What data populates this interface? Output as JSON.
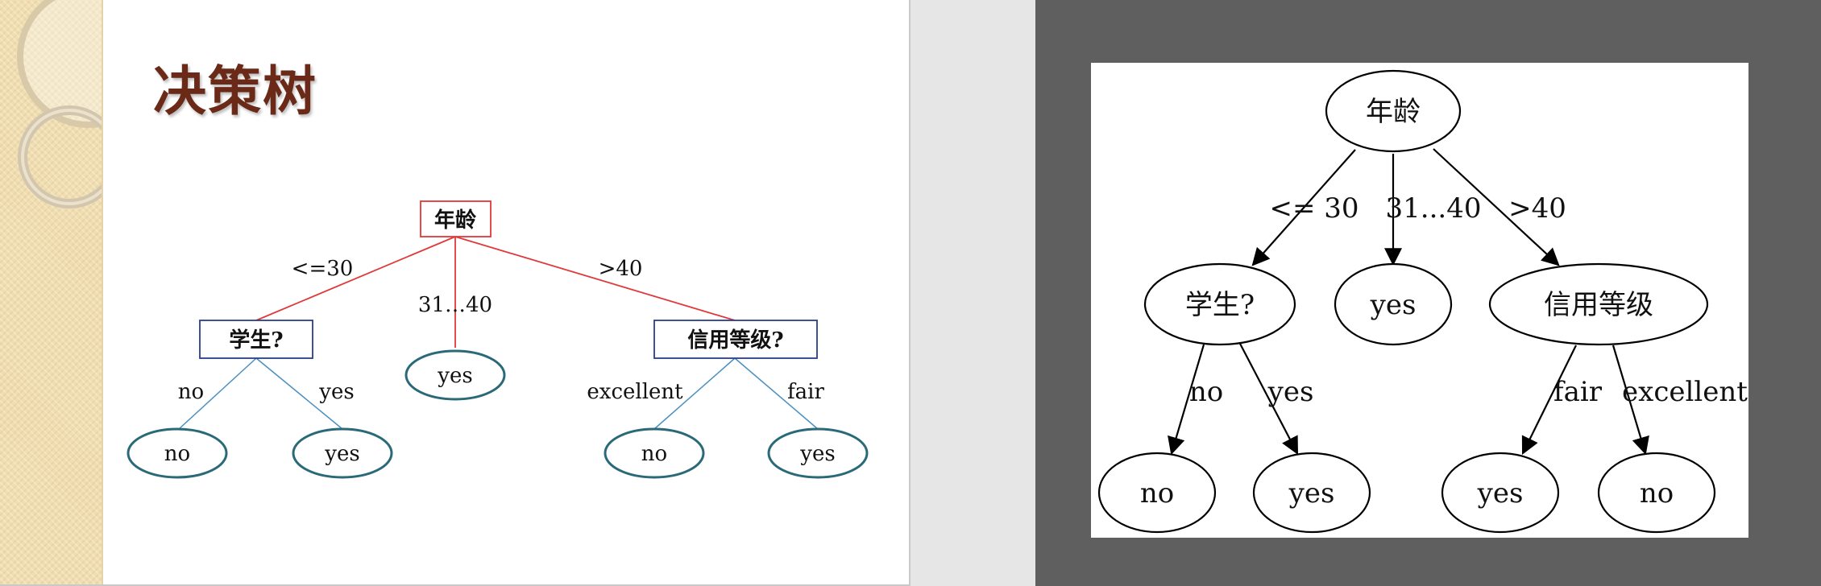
{
  "slide": {
    "title": "决策树",
    "tree": {
      "root": "年龄",
      "edges_from_root": [
        "<=30",
        "31…40",
        ">40"
      ],
      "left_node": "学生?",
      "left_edges": [
        "no",
        "yes"
      ],
      "left_leaves": [
        "no",
        "yes"
      ],
      "middle_leaf": "yes",
      "right_node": "信用等级?",
      "right_edges": [
        "excellent",
        "fair"
      ],
      "right_leaves": [
        "no",
        "yes"
      ]
    },
    "colors": {
      "title": "#6b2a18",
      "root_edges": "#e0393a",
      "lower_edges": "#4a90c0",
      "box_blue": "#2a3e8a",
      "ellipse": "#2a6a78"
    }
  },
  "graphviz": {
    "root": "年龄",
    "edges_from_root": [
      "<= 30",
      "31...40",
      ">40"
    ],
    "left_node": "学生?",
    "left_edges": [
      "no",
      "yes"
    ],
    "left_leaves": [
      "no",
      "yes"
    ],
    "middle_leaf": "yes",
    "right_node": "信用等级",
    "right_edges": [
      "fair",
      "excellent"
    ],
    "right_leaves": [
      "yes",
      "no"
    ]
  }
}
